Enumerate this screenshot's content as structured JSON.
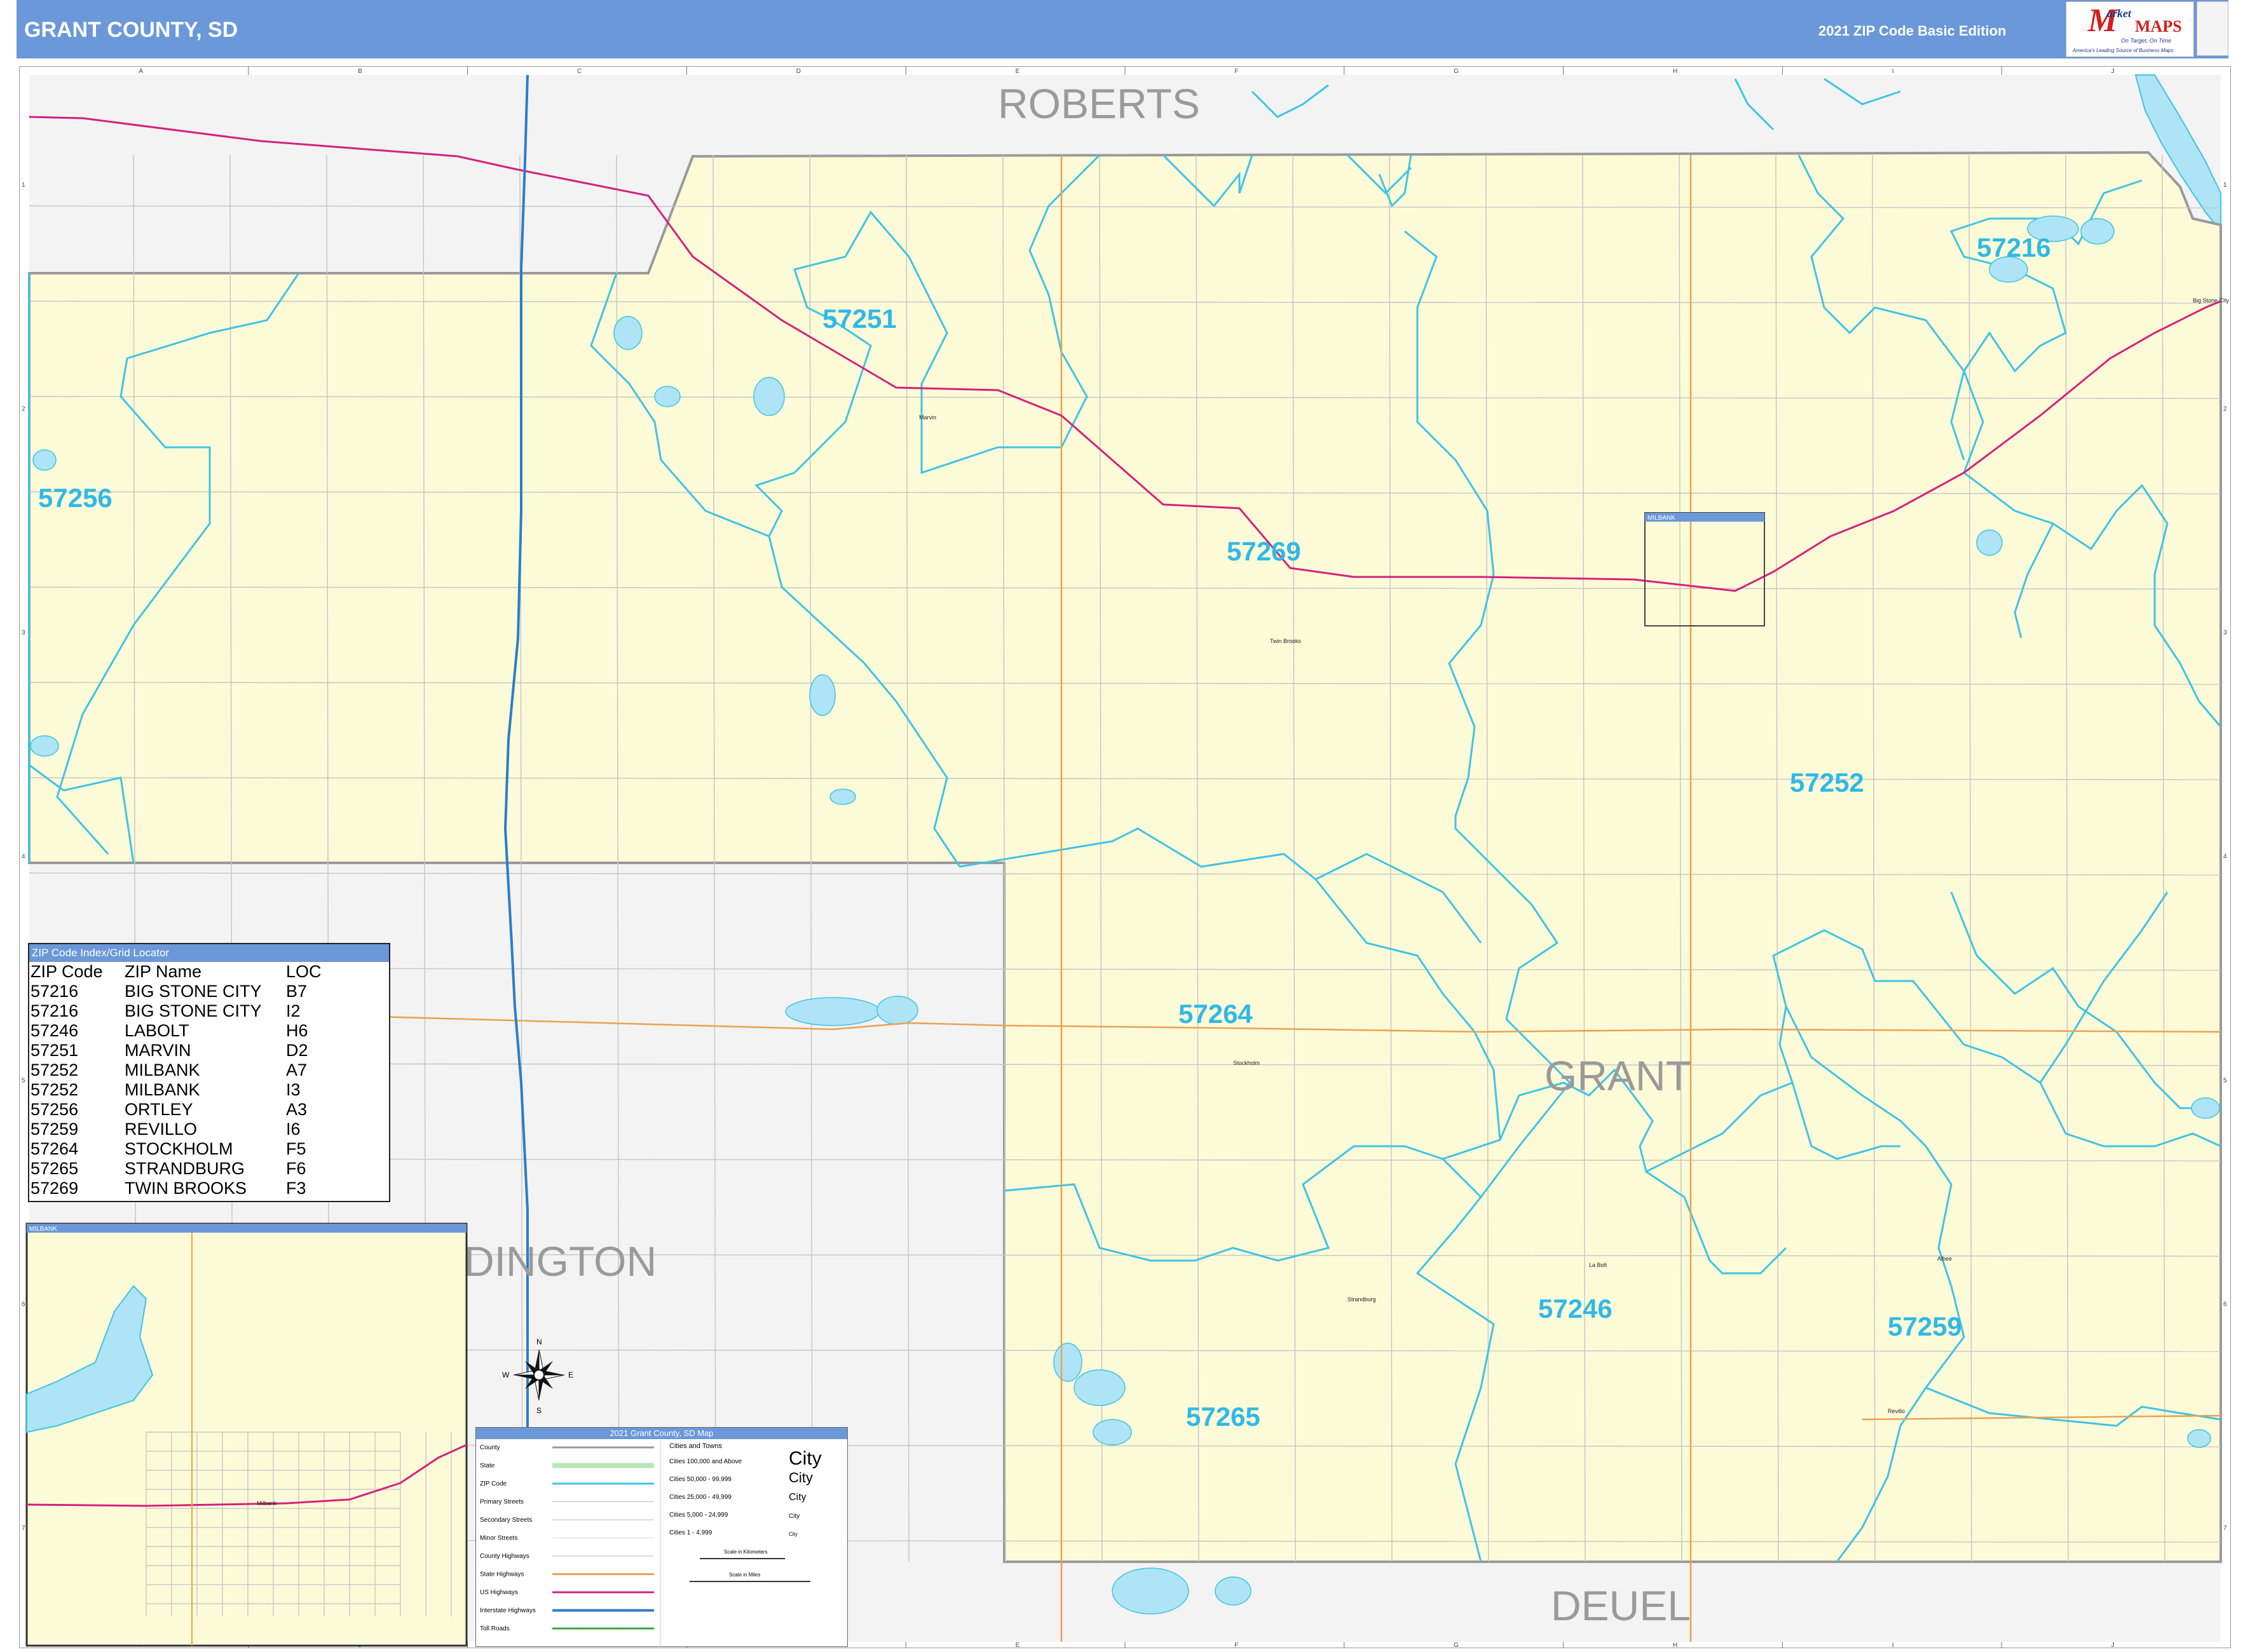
{
  "header": {
    "title": "GRANT COUNTY, SD",
    "edition": "2021 ZIP Code Basic Edition",
    "logo_word1": "arket",
    "logo_word2": "MAPS",
    "logo_tagline": "On Target, On Time",
    "logo_subtagline": "America's Leading Source of Business Maps"
  },
  "grid": {
    "columns": [
      "A",
      "B",
      "C",
      "D",
      "E",
      "F",
      "G",
      "H",
      "I",
      "J"
    ],
    "rows": [
      "1",
      "2",
      "3",
      "4",
      "5",
      "6",
      "7"
    ]
  },
  "neighbor_counties": {
    "north": "ROBERTS",
    "southwest": "DINGTON",
    "south": "DEUEL",
    "center": "GRANT"
  },
  "zip_labels": {
    "z57251": "57251",
    "z57256": "57256",
    "z57216": "57216",
    "z57269": "57269",
    "z57252": "57252",
    "z57264": "57264",
    "z57246": "57246",
    "z57259": "57259",
    "z57265": "57265"
  },
  "towns": {
    "marvin": "Marvin",
    "twin_brooks": "Twin Brooks",
    "stockholm": "Stockholm",
    "la_bolt": "La Bolt",
    "strandburg": "Strandburg",
    "albee": "Albee",
    "revillo": "Revillo",
    "big_stone_city": "Big Stone City",
    "milbank": "Milbank"
  },
  "inset_labels": {
    "main_inset": "MILBANK",
    "locator": "MILBANK"
  },
  "zip_index": {
    "title": "ZIP Code Index/Grid Locator",
    "headers": [
      "ZIP Code",
      "ZIP Name",
      "LOC"
    ],
    "rows": [
      [
        "57216",
        "BIG STONE CITY",
        "B7"
      ],
      [
        "57216",
        "BIG STONE CITY",
        "I2"
      ],
      [
        "57246",
        "LABOLT",
        "H6"
      ],
      [
        "57251",
        "MARVIN",
        "D2"
      ],
      [
        "57252",
        "MILBANK",
        "A7"
      ],
      [
        "57252",
        "MILBANK",
        "I3"
      ],
      [
        "57256",
        "ORTLEY",
        "A3"
      ],
      [
        "57259",
        "REVILLO",
        "I6"
      ],
      [
        "57264",
        "STOCKHOLM",
        "F5"
      ],
      [
        "57265",
        "STRANDBURG",
        "F6"
      ],
      [
        "57269",
        "TWIN BROOKS",
        "F3"
      ]
    ]
  },
  "legend": {
    "title": "2021 Grant County, SD Map",
    "left_items": [
      "County",
      "State",
      "ZIP Code",
      "Primary Streets",
      "Secondary Streets",
      "Minor Streets",
      "County Highways",
      "State Highways",
      "US Highways",
      "Interstate Highways",
      "Toll Roads"
    ],
    "cities_title": "Cities and Towns",
    "city_tiers": [
      "Cities 100,000 and Above",
      "Cities 50,000 - 99,999",
      "Cities 25,000 - 49,999",
      "Cities 5,000 - 24,999",
      "Cities 1 - 4,999"
    ],
    "city_samples": [
      "City",
      "City",
      "City",
      "City",
      "City"
    ],
    "scale_km": "Scale in Kilometers",
    "scale_mi": "Scale in Miles"
  },
  "compass": {
    "n": "N",
    "s": "S",
    "e": "E",
    "w": "W"
  },
  "colors": {
    "header": "#6a98d9",
    "county_fill": "#fdfbd7",
    "outside_fill": "#f3f3f3",
    "zip_line": "#3ec4e6",
    "zip_text": "#2fb9e8",
    "us_highway": "#d6207e",
    "interstate": "#2a7ec9",
    "state_highway": "#e8a250",
    "water": "#aee4f5"
  }
}
